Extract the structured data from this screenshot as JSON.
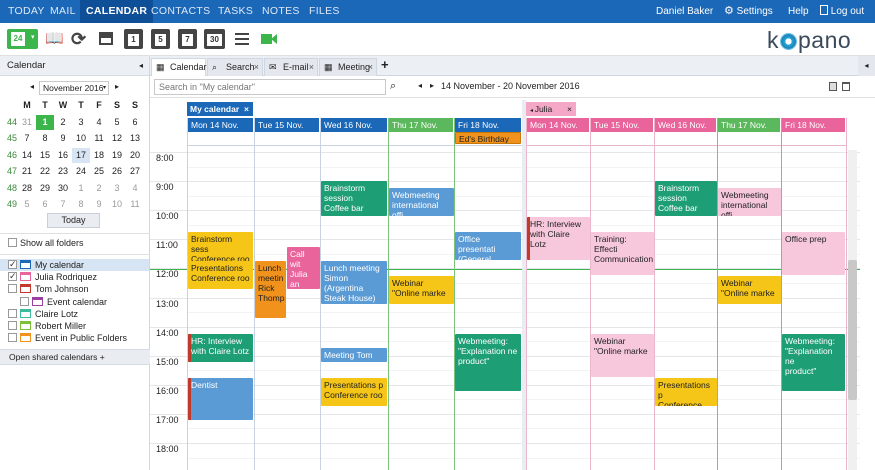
{
  "topnav": {
    "items": [
      "TODAY",
      "MAIL",
      "CALENDAR",
      "CONTACTS",
      "TASKS",
      "NOTES",
      "FILES"
    ],
    "active": "CALENDAR",
    "user": "Daniel Baker",
    "settings": "Settings",
    "help": "Help",
    "logout": "Log out"
  },
  "toolbar": {
    "new_label": "24",
    "day_buttons": [
      "1",
      "5",
      "7",
      "30"
    ],
    "logo": "kopano"
  },
  "left_panel": {
    "title": "Calendar",
    "month_label": "November 2016",
    "dow": [
      "M",
      "T",
      "W",
      "T",
      "F",
      "S",
      "S"
    ],
    "weeks": [
      {
        "wk": "44",
        "days": [
          "31",
          "1",
          "2",
          "3",
          "4",
          "5",
          "6"
        ]
      },
      {
        "wk": "45",
        "days": [
          "7",
          "8",
          "9",
          "10",
          "11",
          "12",
          "13"
        ]
      },
      {
        "wk": "46",
        "days": [
          "14",
          "15",
          "16",
          "17",
          "18",
          "19",
          "20"
        ]
      },
      {
        "wk": "47",
        "days": [
          "21",
          "22",
          "23",
          "24",
          "25",
          "26",
          "27"
        ]
      },
      {
        "wk": "48",
        "days": [
          "28",
          "29",
          "30",
          "1",
          "2",
          "3",
          "4"
        ]
      },
      {
        "wk": "49",
        "days": [
          "5",
          "6",
          "7",
          "8",
          "9",
          "10",
          "11"
        ]
      }
    ],
    "today_button": "Today",
    "show_all": "Show all folders",
    "folders": [
      {
        "label": "My calendar",
        "color": "#1b67b8",
        "checked": true,
        "selected": true
      },
      {
        "label": "Julia Rodriquez",
        "color": "#e8649a",
        "checked": true
      },
      {
        "label": "Tom Johnson",
        "color": "#c0392b",
        "checked": false
      },
      {
        "label": "Event calendar",
        "color": "#9b3fa0",
        "checked": false,
        "indent": true
      },
      {
        "label": "Claire Lotz",
        "color": "#3dbb9c",
        "checked": false
      },
      {
        "label": "Robert Miller",
        "color": "#7cbf3a",
        "checked": false
      },
      {
        "label": "Event in Public Folders",
        "color": "#f0921b",
        "checked": false
      }
    ],
    "open_shared": "Open shared calendars +"
  },
  "tabs": [
    {
      "label": "Calendar",
      "icon": "calendar-icon",
      "active": true
    },
    {
      "label": "Search",
      "icon": "search-icon",
      "close": "×"
    },
    {
      "label": "E-mail",
      "icon": "mail-icon",
      "close": "×"
    },
    {
      "label": "Meeting",
      "icon": "calendar-icon",
      "close": "×"
    }
  ],
  "add_tab": "+",
  "search": {
    "placeholder": "Search in \"My calendar\""
  },
  "date_range": "14 November - 20 November 2016",
  "calendars": [
    {
      "name": "My calendar",
      "close": "×",
      "color": "#1b67b8"
    },
    {
      "name": "Julia",
      "close": "×",
      "color": "#e8649a"
    }
  ],
  "day_headers": [
    "Mon 14 Nov.",
    "Tue 15 Nov.",
    "Wed 16 Nov.",
    "Thu 17 Nov.",
    "Fri 18 Nov."
  ],
  "times": [
    "8:00",
    "9:00",
    "10:00",
    "11:00",
    "12:00",
    "13:00",
    "14:00",
    "15:00",
    "16:00",
    "17:00",
    "18:00"
  ],
  "allday": {
    "label": "Ed's Birthday"
  },
  "events": {
    "e1": "Brainstorm sess\nConference roo",
    "e2": "Presentations\nConference roo",
    "e3": "Lunch\nmeetin\nRick\nThomp",
    "e4": "Call wit\nJulia an\nTom",
    "e5": "HR: Interview\nwith Claire Lotz",
    "e6": "Dentist",
    "e7": "Brainstorm\nsession\nCoffee bar",
    "e8": "Lunch meeting\nSimon\n(Argentina\nSteak House)",
    "e9": "Meeting Tom",
    "e10": "Presentations p\nConference roo",
    "e11": "Webmeeting\ninternational offi",
    "e12": "Webinar\n\"Online marke",
    "e13": "Office presentati\n(General meetin",
    "e14": "Webmeeting:\n\"Explanation ne\nproduct\"",
    "j1": "HR: Interview\nwith Claire Lotz",
    "j2": "Training: Effecti\nCommunication",
    "j3": "Webinar\n\"Online marke",
    "j4": "Brainstorm\nsession\nCoffee bar",
    "j5": "Presentations p\nConference roo",
    "j6": "Webmeeting\ninternational offi",
    "j7": "Webinar\n\"Online marke",
    "j8": "Office prep",
    "j9": "Webmeeting:\n\"Explanation ne\nproduct\""
  }
}
